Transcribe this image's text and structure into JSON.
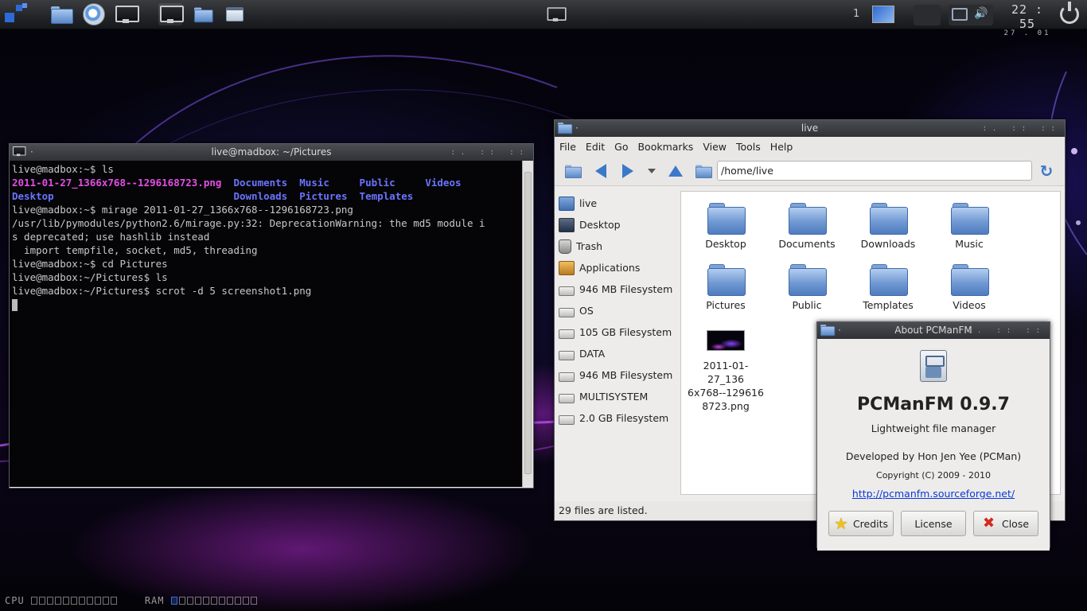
{
  "panel": {
    "launchers": [
      "menu-icon",
      "folder-icon",
      "browser-icon",
      "monitor-icon"
    ],
    "tasks": [
      "terminal-task-icon",
      "file-manager-task-icon",
      "dialog-task-icon"
    ],
    "workspace_number": "1",
    "clock_time": "22 : 55",
    "clock_date": "27 . 01"
  },
  "terminal": {
    "title": "live@madbox: ~/Pictures",
    "lines": [
      [
        {
          "t": "live@madbox:~$ ls",
          "c": ""
        }
      ],
      [
        {
          "t": "2011-01-27_1366x768--1296168723.png",
          "c": "pink"
        },
        {
          "t": "  ",
          "c": ""
        },
        {
          "t": "Documents",
          "c": "blue"
        },
        {
          "t": "  ",
          "c": ""
        },
        {
          "t": "Music",
          "c": "blue"
        },
        {
          "t": "     ",
          "c": ""
        },
        {
          "t": "Public",
          "c": "blue"
        },
        {
          "t": "     ",
          "c": ""
        },
        {
          "t": "Videos",
          "c": "blue"
        }
      ],
      [
        {
          "t": "Desktop",
          "c": "blue"
        },
        {
          "t": "                              ",
          "c": ""
        },
        {
          "t": "Downloads",
          "c": "blue"
        },
        {
          "t": "  ",
          "c": ""
        },
        {
          "t": "Pictures",
          "c": "blue"
        },
        {
          "t": "  ",
          "c": ""
        },
        {
          "t": "Templates",
          "c": "blue"
        }
      ],
      [
        {
          "t": "live@madbox:~$ mirage 2011-01-27_1366x768--1296168723.png",
          "c": ""
        }
      ],
      [
        {
          "t": "/usr/lib/pymodules/python2.6/mirage.py:32: DeprecationWarning: the md5 module i",
          "c": ""
        }
      ],
      [
        {
          "t": "s deprecated; use hashlib instead",
          "c": ""
        }
      ],
      [
        {
          "t": "  import tempfile, socket, md5, threading",
          "c": ""
        }
      ],
      [
        {
          "t": "live@madbox:~$ cd Pictures",
          "c": ""
        }
      ],
      [
        {
          "t": "live@madbox:~/Pictures$ ls",
          "c": ""
        }
      ],
      [
        {
          "t": "live@madbox:~/Pictures$ scrot -d 5 screenshot1.png",
          "c": ""
        }
      ]
    ]
  },
  "file_manager": {
    "title": "live",
    "menu": [
      "File",
      "Edit",
      "Go",
      "Bookmarks",
      "View",
      "Tools",
      "Help"
    ],
    "path": "/home/live",
    "sidebar": [
      {
        "label": "live",
        "icon": "home"
      },
      {
        "label": "Desktop",
        "icon": "desk"
      },
      {
        "label": "Trash",
        "icon": "trash"
      },
      {
        "label": "Applications",
        "icon": "apps"
      },
      {
        "label": "946 MB Filesystem",
        "icon": "drive"
      },
      {
        "label": "OS",
        "icon": "drive"
      },
      {
        "label": "105 GB Filesystem",
        "icon": "drive"
      },
      {
        "label": "DATA",
        "icon": "drive"
      },
      {
        "label": "946 MB Filesystem",
        "icon": "drive"
      },
      {
        "label": "MULTISYSTEM",
        "icon": "drive"
      },
      {
        "label": "2.0 GB Filesystem",
        "icon": "drive"
      }
    ],
    "items": [
      {
        "label": "Desktop",
        "type": "folder"
      },
      {
        "label": "Documents",
        "type": "folder"
      },
      {
        "label": "Downloads",
        "type": "folder"
      },
      {
        "label": "Music",
        "type": "folder"
      },
      {
        "label": "Pictures",
        "type": "folder"
      },
      {
        "label": "Public",
        "type": "folder"
      },
      {
        "label": "Templates",
        "type": "folder"
      },
      {
        "label": "Videos",
        "type": "folder"
      },
      {
        "label": "2011-01-27_1366x768--1296168723.png",
        "type": "image",
        "wrapped": [
          "2011-01-27_136",
          "6x768--129616",
          "8723.png"
        ]
      }
    ],
    "status": "29 files are listed."
  },
  "about": {
    "window_title": "About PCManFM",
    "app_name": "PCManFM 0.9.7",
    "subtitle": "Lightweight file manager",
    "developer": "Developed by Hon Jen Yee (PCMan)",
    "copyright": "Copyright (C) 2009 - 2010",
    "url": "http://pcmanfm.sourceforge.net/",
    "buttons": {
      "credits": "Credits",
      "license": "License",
      "close": "Close"
    }
  },
  "meters": {
    "cpu_label": "CPU",
    "ram_label": "RAM",
    "cpu_on": 0,
    "ram_on": 1,
    "cells": 11
  }
}
